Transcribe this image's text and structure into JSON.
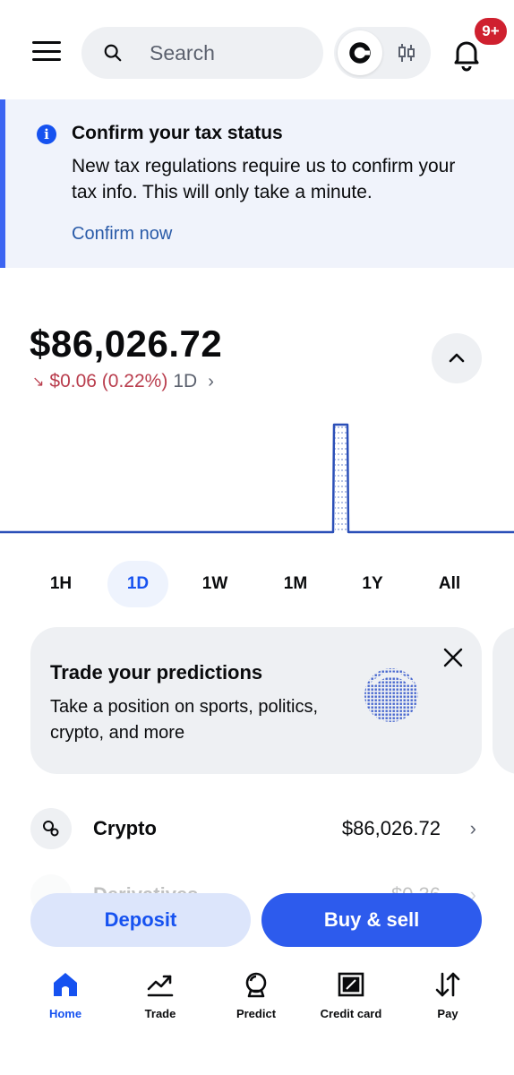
{
  "header": {
    "search_placeholder": "Search",
    "notifications_badge": "9+"
  },
  "banner": {
    "title": "Confirm your tax status",
    "body": "New tax regulations require us to confirm your tax info. This will only take a minute.",
    "link": "Confirm now"
  },
  "portfolio": {
    "balance": "$86,026.72",
    "change_arrow": "↘",
    "change": "$0.06 (0.22%)",
    "period": "1D",
    "chevron": "›"
  },
  "ranges": [
    "1H",
    "1D",
    "1W",
    "1M",
    "1Y",
    "All"
  ],
  "active_range": "1D",
  "promo": {
    "title": "Trade your predictions",
    "body": "Take a position on sports, politics, crypto, and more"
  },
  "assets": [
    {
      "label": "Crypto",
      "value": "$86,026.72"
    },
    {
      "label": "Derivatives",
      "value": "$0.36"
    }
  ],
  "actions": {
    "deposit": "Deposit",
    "buy_sell": "Buy & sell"
  },
  "nav": [
    {
      "label": "Home",
      "icon": "home-icon"
    },
    {
      "label": "Trade",
      "icon": "trend-icon"
    },
    {
      "label": "Predict",
      "icon": "predict-icon"
    },
    {
      "label": "Credit card",
      "icon": "credit-card-icon"
    },
    {
      "label": "Pay",
      "icon": "transfer-arrows-icon"
    }
  ],
  "colors": {
    "accent": "#1652f0",
    "negative": "#b93d4d",
    "chart_line": "#2b4fb8"
  }
}
